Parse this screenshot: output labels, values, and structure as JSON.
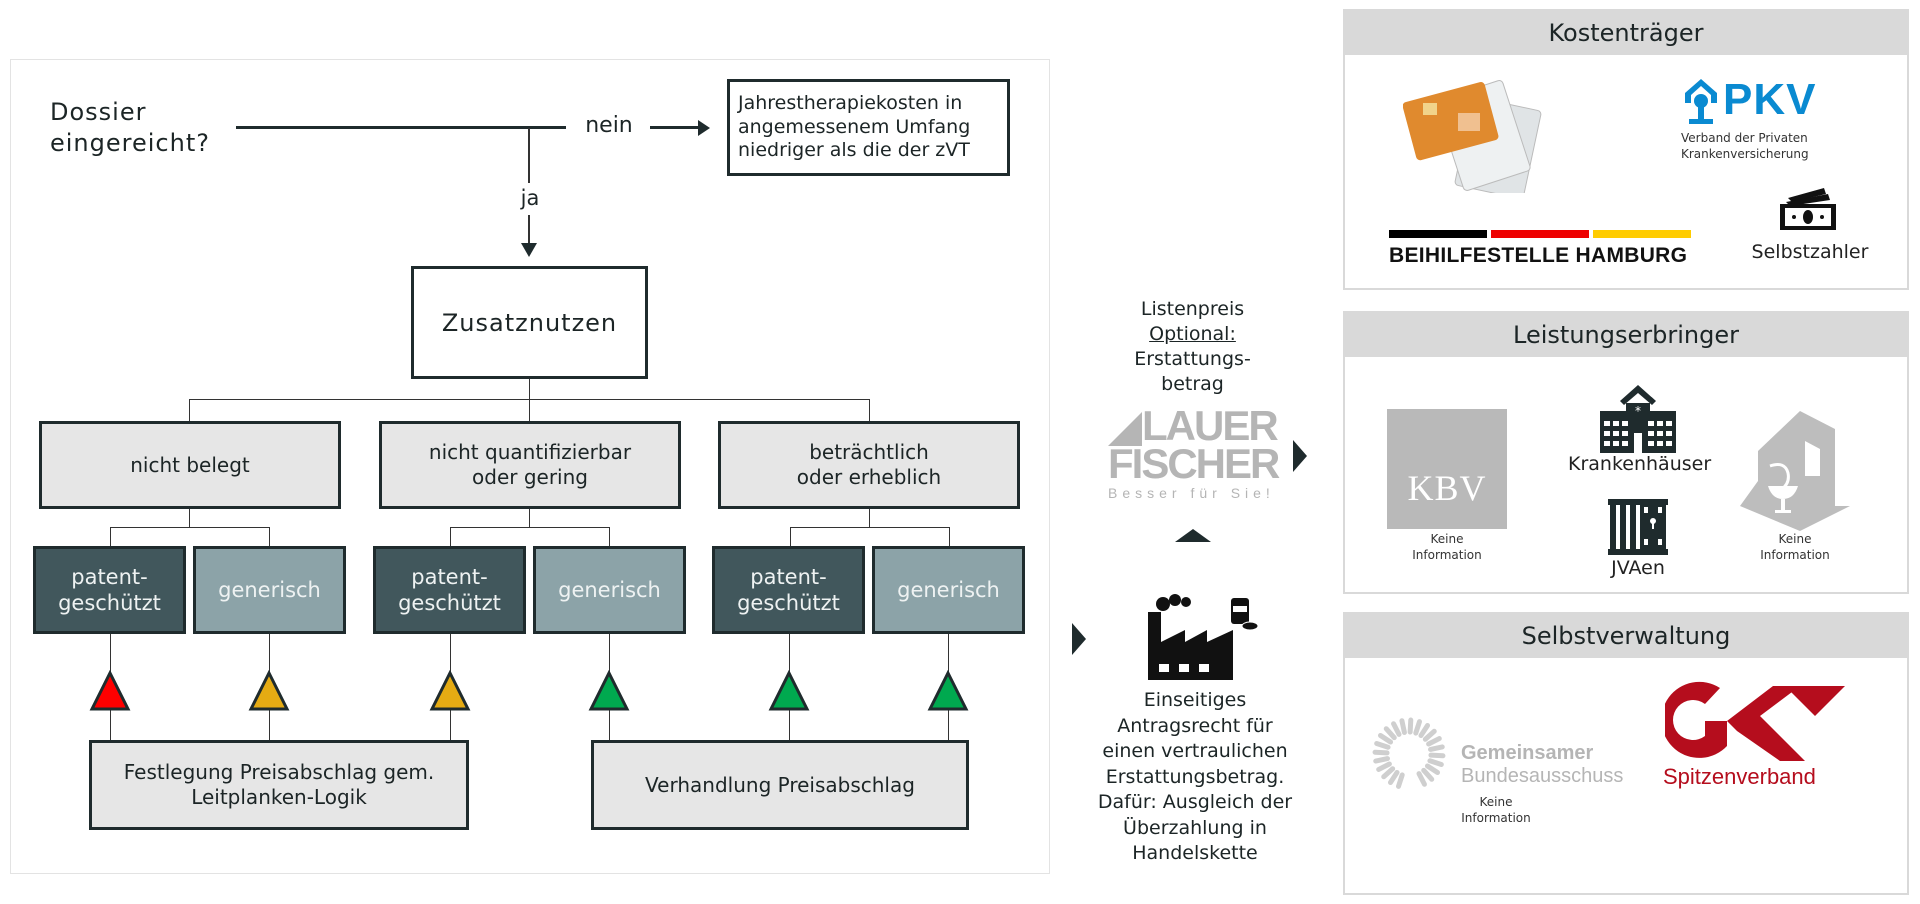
{
  "flow": {
    "question": [
      "Dossier",
      "eingereicht?"
    ],
    "no_label": "nein",
    "yes_label": "ja",
    "no_result": [
      "Jahrestherapiekosten in",
      "angemessenem Umfang",
      "niedriger als die der zVT"
    ],
    "benefit_box": "Zusatznutzen",
    "categories": [
      {
        "label": [
          "nicht belegt"
        ]
      },
      {
        "label": [
          "nicht quantifizierbar",
          "oder gering"
        ]
      },
      {
        "label": [
          "beträchtlich",
          "oder erheblich"
        ]
      }
    ],
    "subtypes": [
      {
        "label": [
          "patent-",
          "geschützt"
        ],
        "kind": "patented",
        "signal": "red"
      },
      {
        "label": [
          "generisch"
        ],
        "kind": "generic",
        "signal": "yellow"
      },
      {
        "label": [
          "patent-",
          "geschützt"
        ],
        "kind": "patented",
        "signal": "yellow"
      },
      {
        "label": [
          "generisch"
        ],
        "kind": "generic",
        "signal": "green"
      },
      {
        "label": [
          "patent-",
          "geschützt"
        ],
        "kind": "patented",
        "signal": "green"
      },
      {
        "label": [
          "generisch"
        ],
        "kind": "generic",
        "signal": "green"
      }
    ],
    "outcomes": [
      {
        "label": [
          "Festlegung Preisabschlag gem.",
          "Leitplanken-Logik"
        ]
      },
      {
        "label": [
          "Verhandlung Preisabschlag"
        ]
      }
    ],
    "signal_colors": {
      "red": "#ff0000",
      "yellow": "#e5ab13",
      "green": "#00a94f"
    }
  },
  "middle": {
    "price_text": [
      "Listenpreis",
      "Optional:",
      "Erstattungs-",
      "betrag"
    ],
    "lauer_logo": {
      "line1": "LAUER",
      "line2": "FISCHER",
      "tagline": "Besser für Sie!"
    },
    "manufacturer_text": [
      "Einseitiges",
      "Antragsrecht für",
      "einen vertraulichen",
      "Erstattungsbetrag.",
      "Dafür: Ausgleich der",
      "Überzahlung in",
      "Handelskette"
    ]
  },
  "panels": {
    "kostentraeger": {
      "title": "Kostenträger",
      "pkv": {
        "name": "PKV",
        "sub1": "Verband der Privaten",
        "sub2": "Krankenversicherung"
      },
      "beihilfe": "BEIHILFESTELLE HAMBURG",
      "selbstzahler": "Selbstzahler"
    },
    "leistungserbringer": {
      "title": "Leistungserbringer",
      "kbv": {
        "logo": "KBV",
        "note": [
          "Keine",
          "Information"
        ]
      },
      "krankenhaeuser": "Krankenhäuser",
      "jvaen": "JVAen",
      "apotheke": {
        "note": [
          "Keine",
          "Information"
        ]
      }
    },
    "selbstverwaltung": {
      "title": "Selbstverwaltung",
      "gba": {
        "line1": "Gemeinsamer",
        "line2": "Bundesausschuss",
        "note": [
          "Keine",
          "Information"
        ]
      },
      "gkv": {
        "logo": "GKV",
        "sub": "Spitzenverband"
      }
    }
  },
  "colors": {
    "dark": "#41575c",
    "mid": "#8ca3a8",
    "light": "#e6e6e6",
    "border": "#1f2b2d",
    "pkv_blue": "#0a8ad1",
    "gkv_red": "#b50d1d",
    "panel_header": "#d9d9d9"
  }
}
